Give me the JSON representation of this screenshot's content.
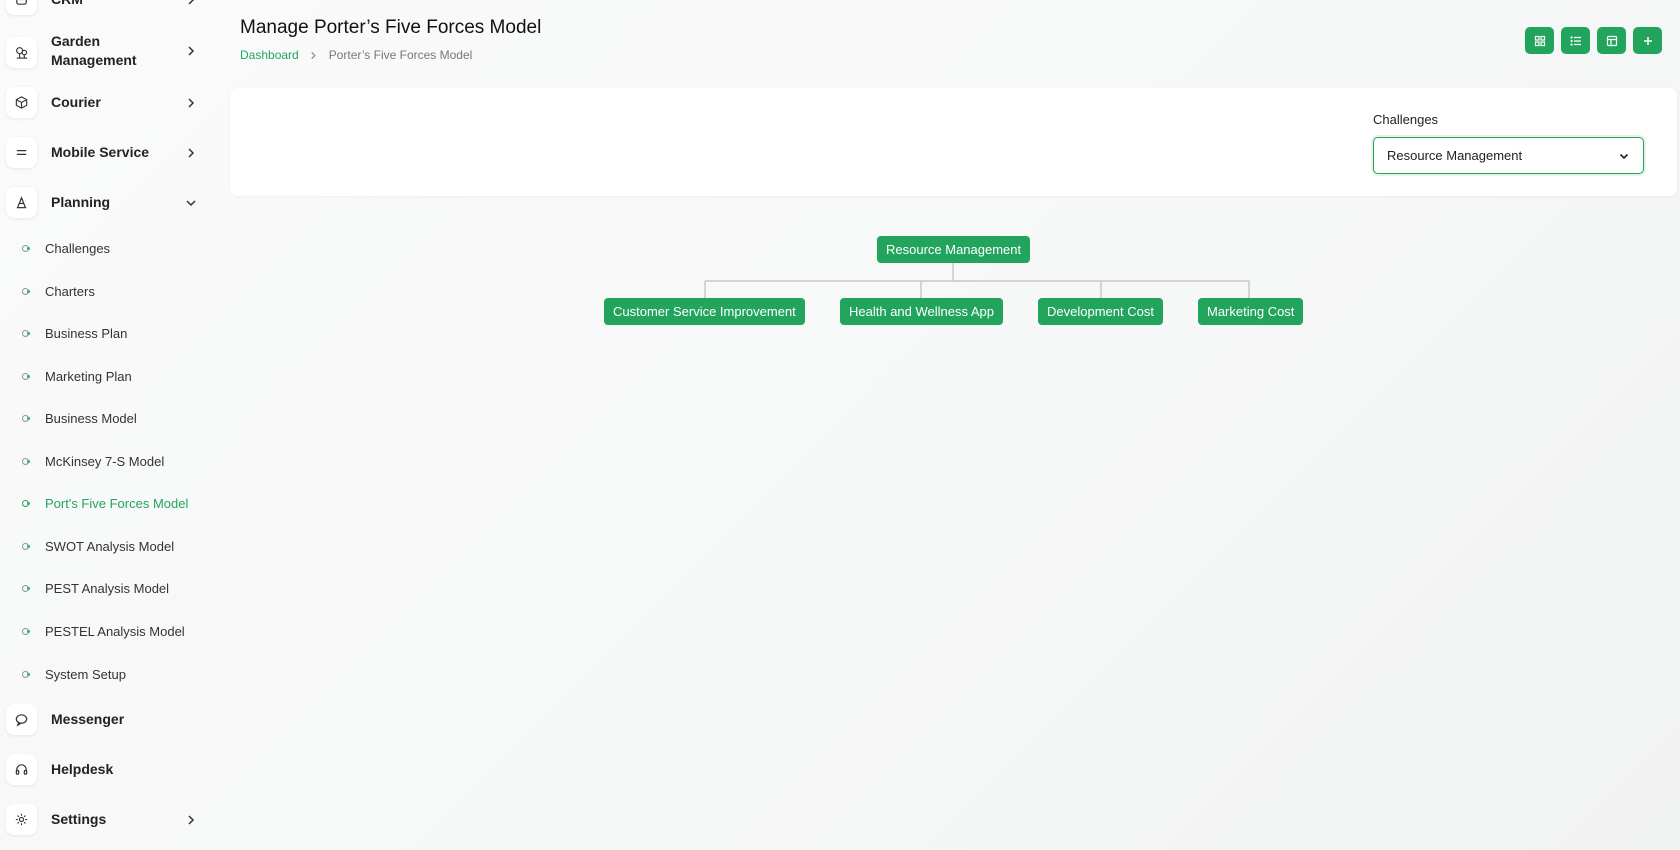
{
  "sidebar": {
    "items": [
      {
        "label": "CRM",
        "icon": "crm-icon"
      },
      {
        "label": "Garden Management",
        "icon": "garden-icon"
      },
      {
        "label": "Courier",
        "icon": "box-icon"
      },
      {
        "label": "Mobile Service",
        "icon": "mobile-service-icon"
      },
      {
        "label": "Planning",
        "icon": "planning-icon"
      },
      {
        "label": "Messenger",
        "icon": "chat-icon"
      },
      {
        "label": "Helpdesk",
        "icon": "headset-icon"
      },
      {
        "label": "Settings",
        "icon": "gear-icon"
      }
    ],
    "sub_items": [
      "Challenges",
      "Charters",
      "Business Plan",
      "Marketing Plan",
      "Business Model",
      "McKinsey 7-S Model",
      "Port's Five Forces Model",
      "SWOT Analysis Model",
      "PEST Analysis Model",
      "PESTEL Analysis Model",
      "System Setup"
    ],
    "active_sub": "Port's Five Forces Model"
  },
  "header": {
    "title": "Manage Porter’s Five Forces Model",
    "breadcrumb_home": "Dashboard",
    "breadcrumb_current": "Porter’s Five Forces Model"
  },
  "toolbar": {
    "buttons": [
      "grid-view-icon",
      "list-view-icon",
      "table-view-icon",
      "plus-icon"
    ]
  },
  "filter": {
    "label": "Challenges",
    "selected": "Resource Management"
  },
  "tree": {
    "root": "Resource Management",
    "children": [
      "Customer Service Improvement",
      "Health and Wellness App",
      "Development Cost",
      "Marketing Cost"
    ]
  },
  "colors": {
    "accent": "#22a45d",
    "background": "#f6f7f7"
  }
}
